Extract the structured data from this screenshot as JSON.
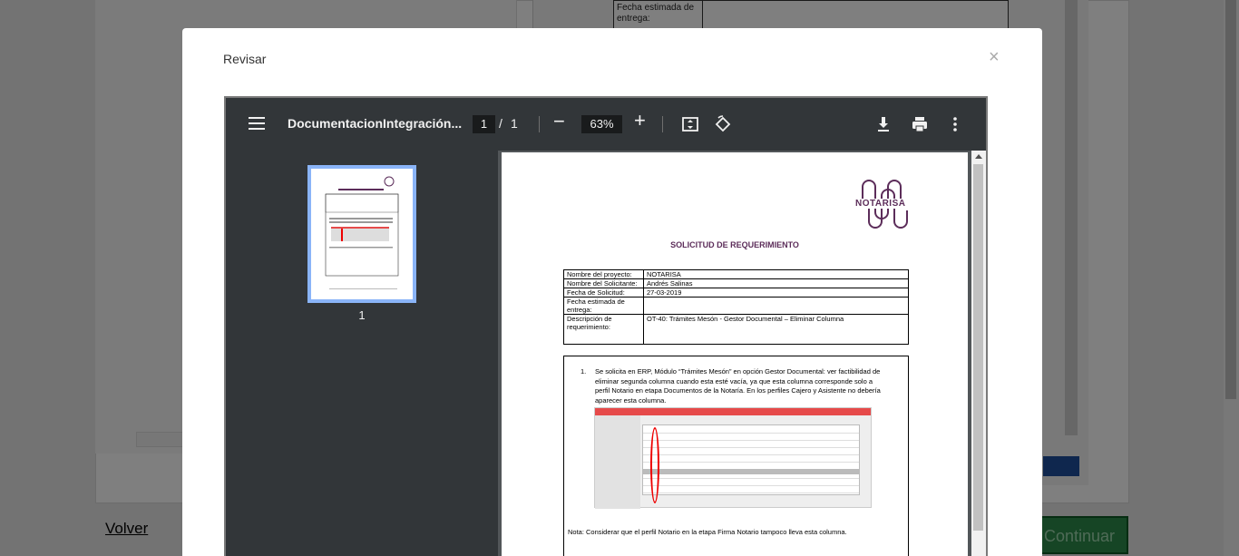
{
  "background": {
    "table_label": "Fecha estimada de entrega:",
    "back_link": "Volver",
    "continue_button": "Continuar"
  },
  "modal": {
    "title": "Revisar",
    "close": "×"
  },
  "viewer": {
    "filename": "DocumentacionIntegración...",
    "current_page": "1",
    "page_separator": "/",
    "total_pages": "1",
    "zoom": "63%",
    "zoom_out": "−",
    "zoom_in": "+",
    "thumbnail_label": "1",
    "icons": [
      "menu-icon",
      "fit-page-icon",
      "rotate-icon",
      "download-icon",
      "print-icon",
      "more-vert-icon"
    ]
  },
  "document": {
    "logo_text": "NOTARISA",
    "title": "SOLICITUD DE REQUERIMIENTO",
    "rows": [
      {
        "key": "Nombre del proyecto:",
        "value": "NOTARISA"
      },
      {
        "key": "Nombre del Solicitante:",
        "value": "Andrés Salinas"
      },
      {
        "key": "Fecha de Solicitud:",
        "value": "27-03-2019"
      },
      {
        "key": "Fecha estimada de entrega:",
        "value": ""
      },
      {
        "key": "Descripción de requerimiento:",
        "value": "OT-40: Trámites Mesón - Gestor Documental – Eliminar Columna"
      }
    ],
    "item_number": "1.",
    "item_text": "Se solicita en ERP, Módulo “Trámites Mesón” en opción Gestor Documental:  ver factibilidad de eliminar segunda columna cuando esta esté vacía, ya que esta columna corresponde solo a perfil Notario en etapa Documentos de la Notaría. En los perfiles Cajero y Asistente no debería aparecer esta columna.",
    "note": "Nota: Considerar que el perfil Notario en la etapa Firma Notario tampoco lleva esta columna."
  },
  "colors": {
    "toolbar": "#323639",
    "viewer_bg": "#525659",
    "brand": "#5c2d5a",
    "continue_green": "#2d8a4a",
    "thumb_highlight": "#8ab4f8"
  }
}
